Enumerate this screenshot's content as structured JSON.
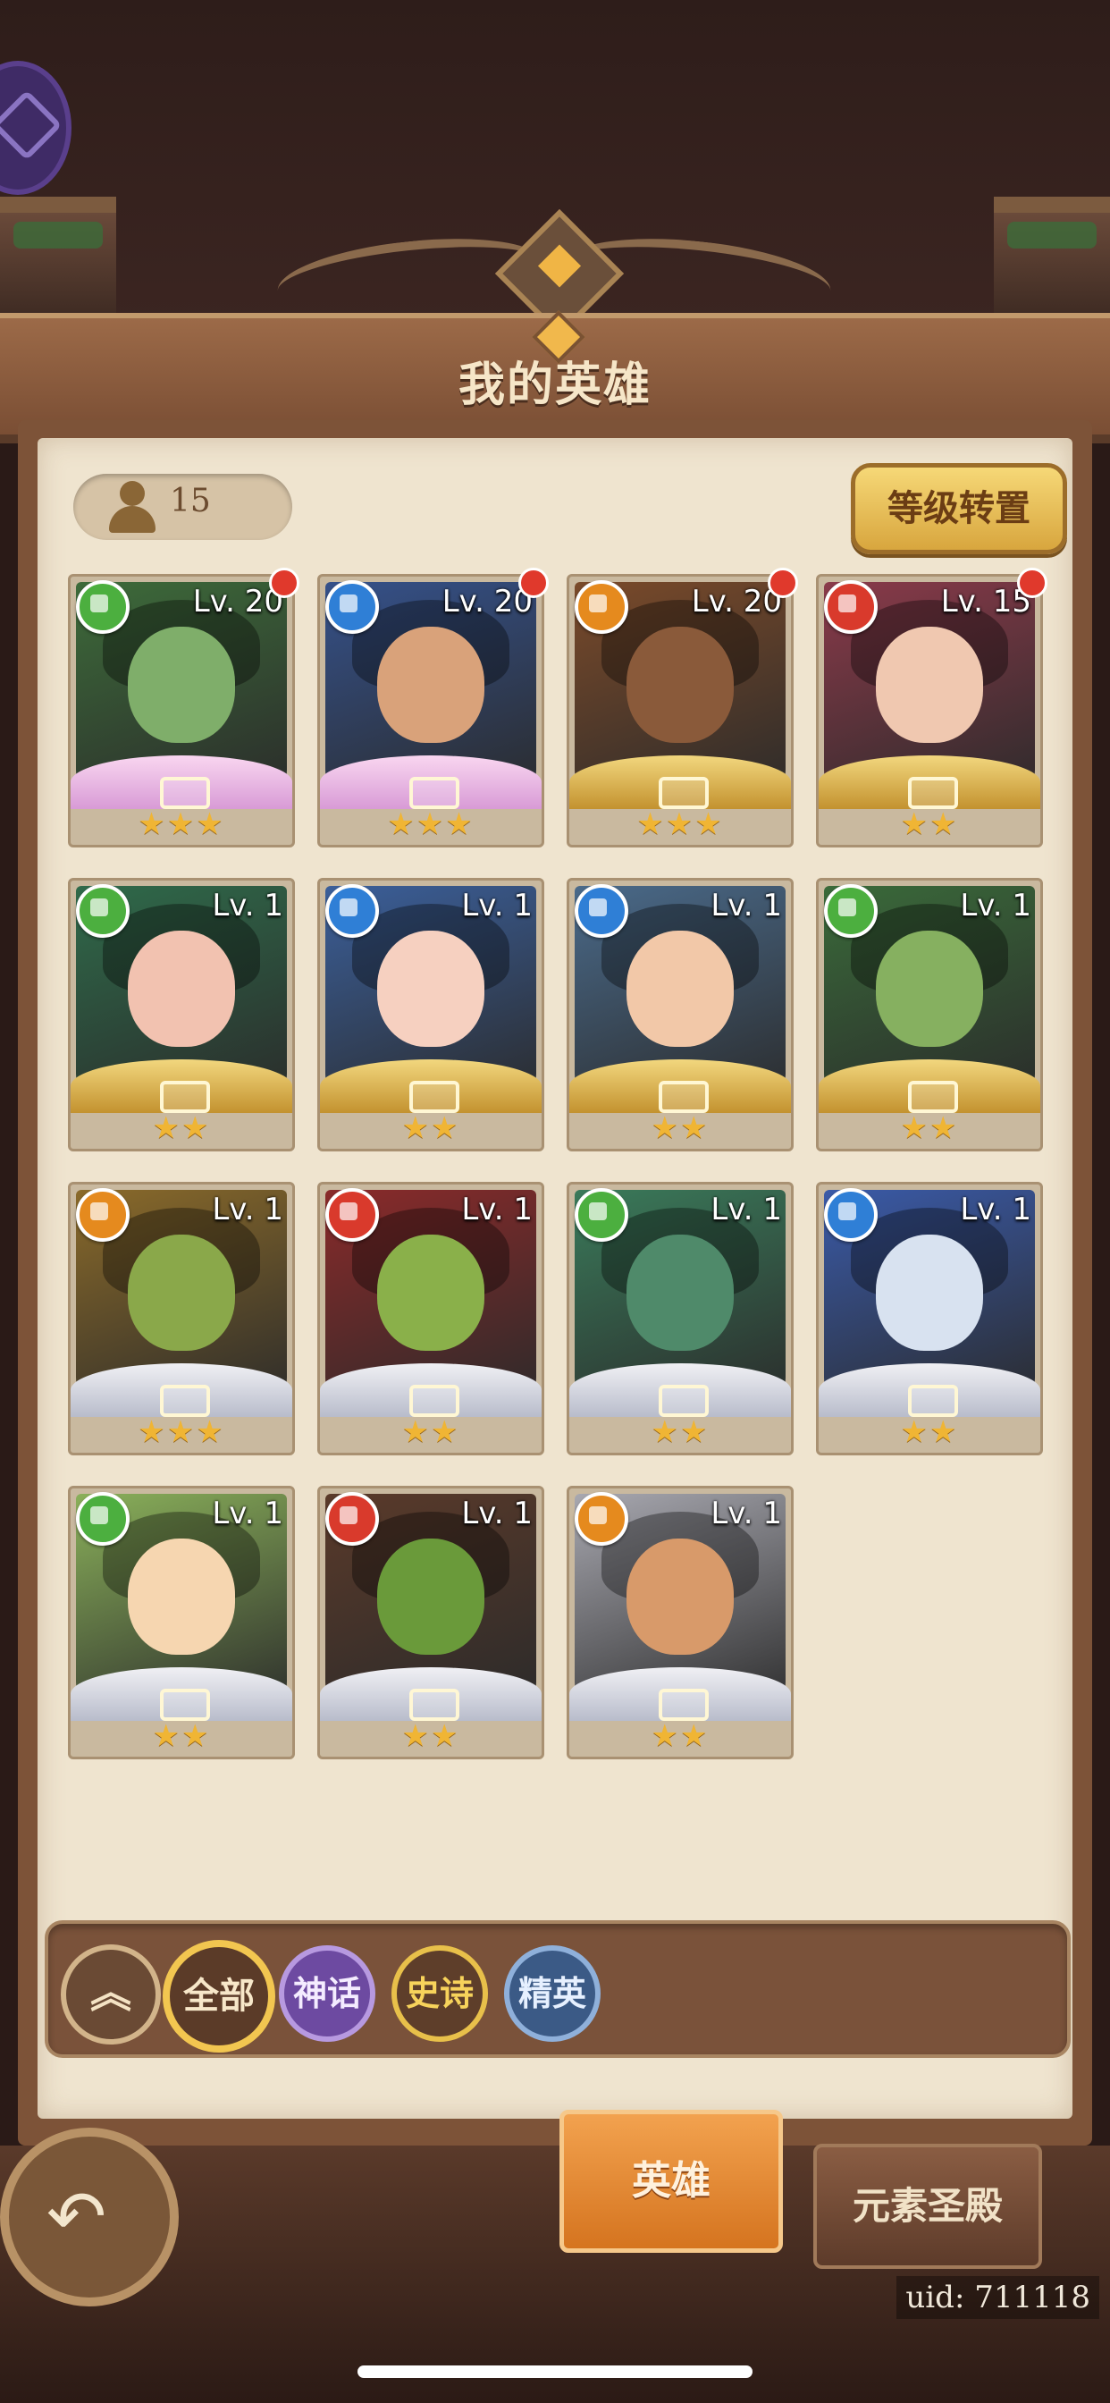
{
  "header": {
    "title": "我的英雄"
  },
  "hero_count": "15",
  "level_transfer_label": "等级转置",
  "heroes": [
    {
      "level": "Lv. 20",
      "element": "nature",
      "stars": "★★★",
      "frame": "pink",
      "red_dot": true
    },
    {
      "level": "Lv. 20",
      "element": "water",
      "stars": "★★★",
      "frame": "pink",
      "red_dot": true
    },
    {
      "level": "Lv. 20",
      "element": "light",
      "stars": "★★★",
      "frame": "gold",
      "red_dot": true
    },
    {
      "level": "Lv. 15",
      "element": "fire",
      "stars": "★★",
      "frame": "gold",
      "red_dot": true
    },
    {
      "level": "Lv. 1",
      "element": "nature",
      "stars": "★★",
      "frame": "gold",
      "red_dot": false
    },
    {
      "level": "Lv. 1",
      "element": "water",
      "stars": "★★",
      "frame": "gold",
      "red_dot": false
    },
    {
      "level": "Lv. 1",
      "element": "water",
      "stars": "★★",
      "frame": "gold",
      "red_dot": false
    },
    {
      "level": "Lv. 1",
      "element": "nature",
      "stars": "★★",
      "frame": "gold",
      "red_dot": false
    },
    {
      "level": "Lv. 1",
      "element": "light",
      "stars": "★★★",
      "frame": "silver",
      "red_dot": false
    },
    {
      "level": "Lv. 1",
      "element": "fire",
      "stars": "★★",
      "frame": "silver",
      "red_dot": false
    },
    {
      "level": "Lv. 1",
      "element": "nature",
      "stars": "★★",
      "frame": "silver",
      "red_dot": false
    },
    {
      "level": "Lv. 1",
      "element": "water",
      "stars": "★★",
      "frame": "silver",
      "red_dot": false
    },
    {
      "level": "Lv. 1",
      "element": "nature",
      "stars": "★★",
      "frame": "silver",
      "red_dot": false
    },
    {
      "level": "Lv. 1",
      "element": "fire",
      "stars": "★★",
      "frame": "silver",
      "red_dot": false
    },
    {
      "level": "Lv. 1",
      "element": "light",
      "stars": "★★",
      "frame": "silver",
      "red_dot": false
    }
  ],
  "filters": {
    "all": "全部",
    "mythic": "神话",
    "epic": "史诗",
    "elite": "精英",
    "collapse_icon": "double-chevron-up-icon"
  },
  "tabs": {
    "hero": "英雄",
    "temple": "元素圣殿"
  },
  "uid": "uid: 711118",
  "colors": {
    "nature": "#4caf3f",
    "water": "#2f7fd6",
    "light": "#e58a1e",
    "fire": "#d93a2c",
    "accent_gold": "#f2c650"
  }
}
